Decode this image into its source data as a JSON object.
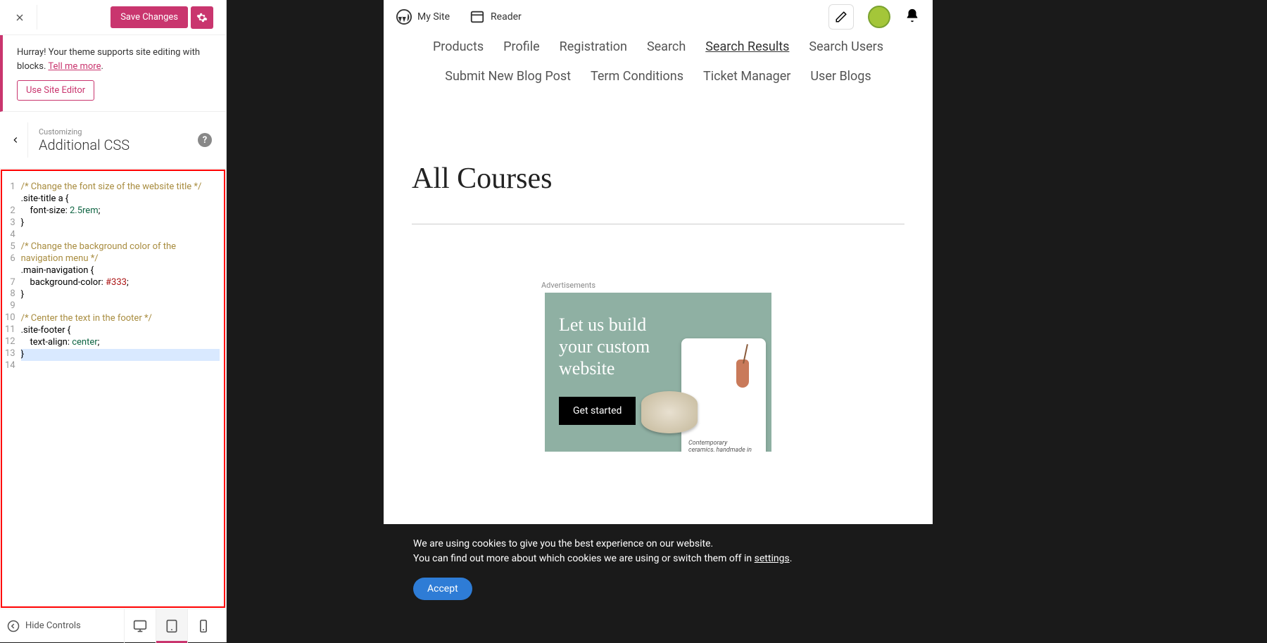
{
  "sidebar": {
    "save_label": "Save Changes",
    "notice_text": "Hurray! Your theme supports site editing with blocks. ",
    "notice_link": "Tell me more",
    "site_editor_btn": "Use Site Editor",
    "customizing_label": "Customizing",
    "panel_title": "Additional CSS",
    "hide_controls": "Hide Controls"
  },
  "code": {
    "lines": [
      {
        "n": 1,
        "type": "comment",
        "text": "/* Change the font size of the website title */"
      },
      {
        "n": 2,
        "type": "selector",
        "text": ".site-title a {"
      },
      {
        "n": 3,
        "type": "decl",
        "prop": "font-size",
        "value": "2.5rem",
        "value_kind": "number"
      },
      {
        "n": 4,
        "type": "brace",
        "text": "}"
      },
      {
        "n": 5,
        "type": "blank",
        "text": ""
      },
      {
        "n": 6,
        "type": "comment",
        "text": "/* Change the background color of the navigation menu */"
      },
      {
        "n": 7,
        "type": "selector",
        "text": ".main-navigation {"
      },
      {
        "n": 8,
        "type": "decl",
        "prop": "background-color",
        "value": "#333",
        "value_kind": "hex"
      },
      {
        "n": 9,
        "type": "brace",
        "text": "}"
      },
      {
        "n": 10,
        "type": "blank",
        "text": ""
      },
      {
        "n": 11,
        "type": "comment",
        "text": "/* Center the text in the footer */"
      },
      {
        "n": 12,
        "type": "selector",
        "text": ".site-footer {"
      },
      {
        "n": 13,
        "type": "decl",
        "prop": "text-align",
        "value": "center",
        "value_kind": "value"
      },
      {
        "n": 14,
        "type": "brace",
        "text": "}",
        "highlighted": true
      }
    ]
  },
  "preview": {
    "toolbar": {
      "my_site": "My Site",
      "reader": "Reader"
    },
    "nav_items_row1": [
      {
        "label": "Products",
        "active": false
      },
      {
        "label": "Profile",
        "active": false
      },
      {
        "label": "Registration",
        "active": false
      },
      {
        "label": "Search",
        "active": false
      },
      {
        "label": "Search Results",
        "active": true
      },
      {
        "label": "Search Users",
        "active": false
      }
    ],
    "nav_items_row2": [
      {
        "label": "Submit New Blog Post"
      },
      {
        "label": "Term Conditions"
      },
      {
        "label": "Ticket Manager"
      },
      {
        "label": "User Blogs"
      }
    ],
    "page_title": "All Courses",
    "ad": {
      "label": "Advertisements",
      "headline": "Let us build your custom website",
      "cta": "Get started",
      "phone_caption": "Contemporary ceramics, handmade in Australia."
    },
    "cookie": {
      "line1": "We are using cookies to give you the best experience on our website.",
      "line2a": "You can find out more about which cookies we are using or switch them off in ",
      "line2b": "settings",
      "accept": "Accept"
    }
  }
}
